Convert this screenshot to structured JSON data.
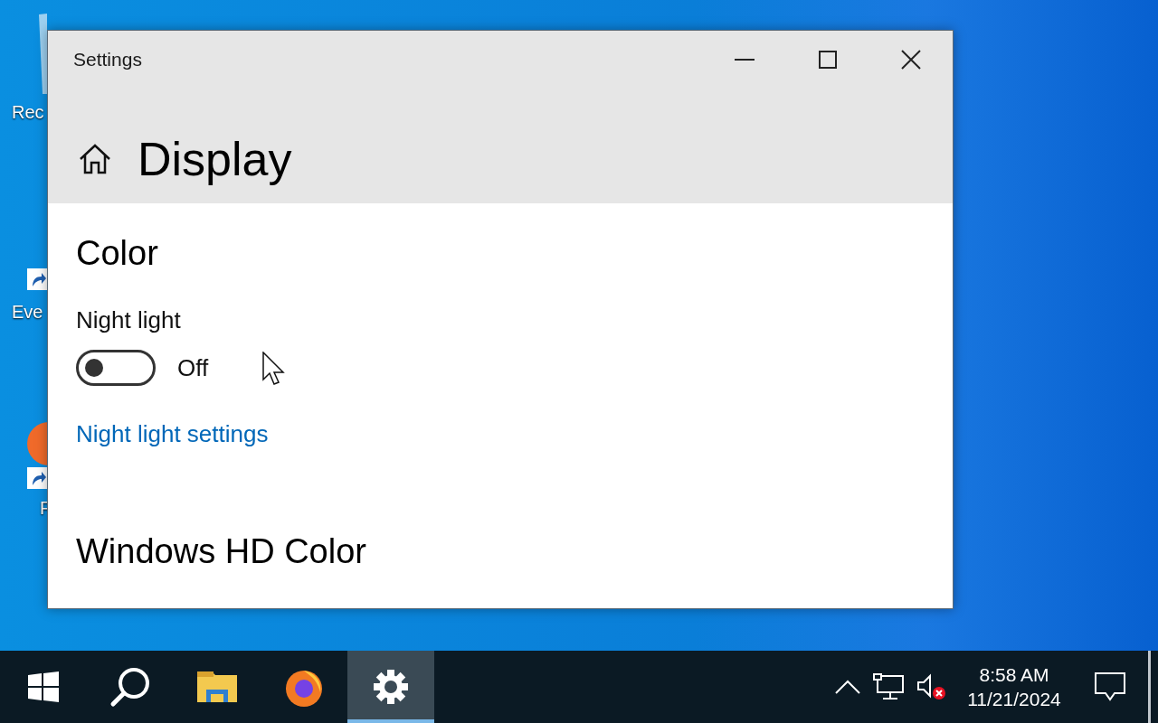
{
  "desktop_icons": [
    {
      "kind": "recycle",
      "label": "Rec"
    },
    {
      "kind": "shortcut",
      "label": "Eve"
    },
    {
      "kind": "firefox",
      "label": "F"
    }
  ],
  "window": {
    "title": "Settings",
    "header": "Display",
    "section": "Color",
    "night_light": {
      "label": "Night light",
      "on": false,
      "state_text": "Off"
    },
    "link": "Night light settings",
    "next_section": "Windows HD Color"
  },
  "taskbar": {
    "apps": [
      {
        "kind": "start",
        "selected": false
      },
      {
        "kind": "search",
        "selected": false
      },
      {
        "kind": "folder",
        "selected": false
      },
      {
        "kind": "firefox",
        "selected": false
      },
      {
        "kind": "settings",
        "selected": true
      }
    ],
    "clock": {
      "time": "8:58 AM",
      "date": "11/21/2024"
    }
  }
}
